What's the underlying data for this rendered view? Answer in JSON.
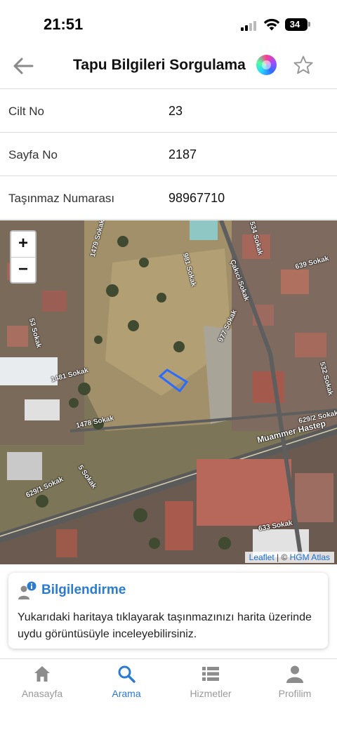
{
  "status_bar": {
    "time": "21:51",
    "battery": "34"
  },
  "header": {
    "title": "Tapu Bilgileri Sorgulama",
    "back_icon": "arrow-left-icon",
    "star_icon": "star-outline-icon"
  },
  "rows": [
    {
      "label": "Cilt No",
      "value": "23"
    },
    {
      "label": "Sayfa No",
      "value": "2187"
    },
    {
      "label": "Taşınmaz Numarası",
      "value": "98967710"
    }
  ],
  "map": {
    "zoom_in": "+",
    "zoom_out": "−",
    "attribution_leaflet": "Leaflet",
    "attribution_separator": " | © ",
    "attribution_source": "HGM Atlas",
    "parcel_color": "#2a6bff",
    "labels": {
      "s1479": "1479 Sokak",
      "s5341": "534 Sokak",
      "s639": "639 Sokak",
      "s981": "981 Sokak",
      "sfakdi": "Çakıci Sokak",
      "s977": "977 Sokak",
      "s53": "53 Sokak",
      "s1481": "1481 Sokak",
      "s532": "532 Sokak",
      "s1478": "1478 Sokak",
      "s6292": "629/2 Sokak",
      "muammer": "Muammer Hastep",
      "s5": "5 Sokak",
      "s6291": "629/1 Sokak",
      "s633": "633 Sokak"
    }
  },
  "info_card": {
    "title": "Bilgilendirme",
    "text": "Yukarıdaki haritaya tıklayarak taşınmazınızı harita üzerinde uydu görüntüsüyle inceleyebilirsiniz.",
    "accent": "#2a7bd1"
  },
  "bottom_nav": [
    {
      "label": "Anasayfa",
      "icon": "home-icon",
      "active": false
    },
    {
      "label": "Arama",
      "icon": "search-icon",
      "active": true
    },
    {
      "label": "Hizmetler",
      "icon": "list-icon",
      "active": false
    },
    {
      "label": "Profilim",
      "icon": "user-icon",
      "active": false
    }
  ]
}
